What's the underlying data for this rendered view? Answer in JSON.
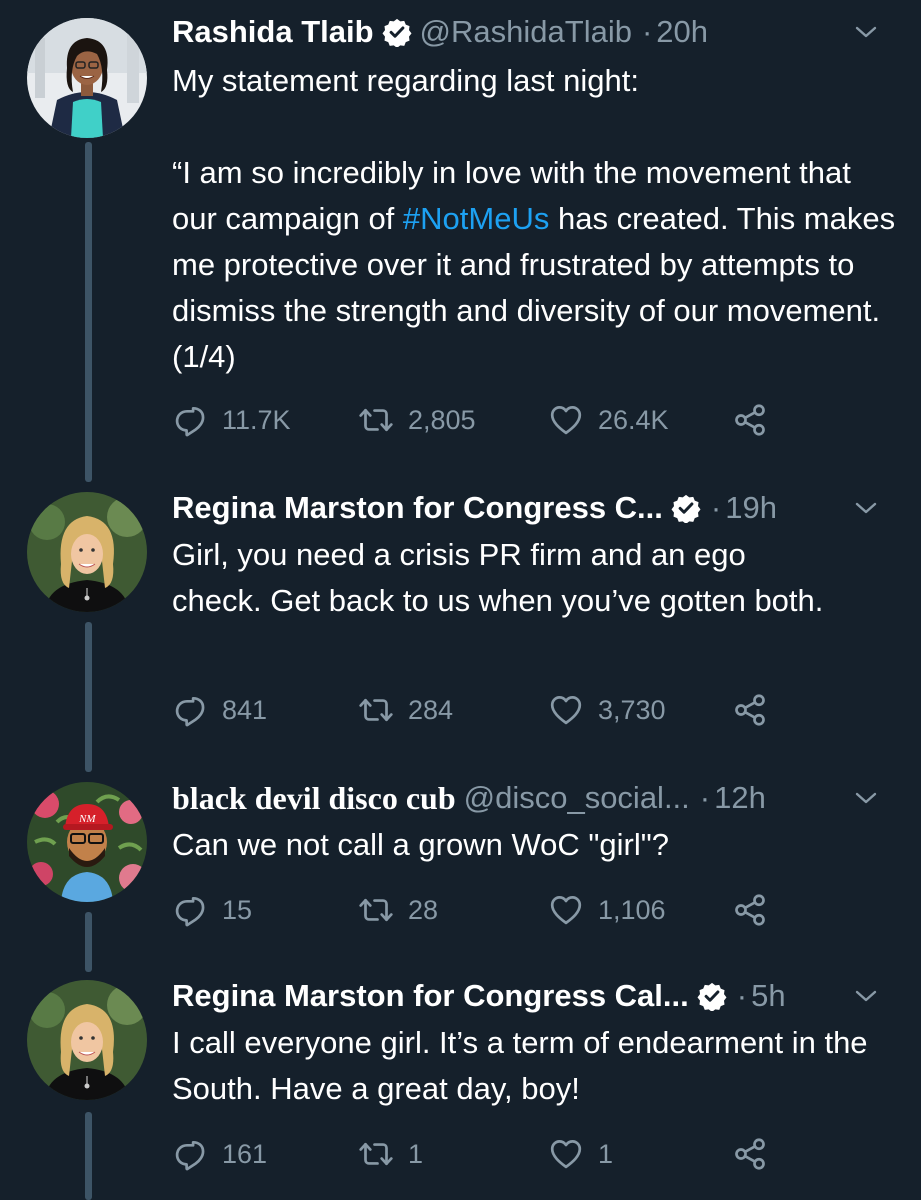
{
  "tweets": [
    {
      "name": "Rashida Tlaib",
      "handle": "@RashidaTlaib",
      "dot": "·",
      "time": "20h",
      "text_before": "My statement regarding last night:\n\n“I am so incredibly in love with the movement that our campaign of ",
      "hashtag": "#NotMeUs",
      "text_after": " has created. This makes me protective over it and frustrated by attempts to dismiss the strength and diversity of our movement. (1/4)",
      "replies": "11.7K",
      "retweets": "2,805",
      "likes": "26.4K"
    },
    {
      "name": "Regina Marston for Congress C...",
      "handle": "",
      "dot": "·",
      "time": "19h",
      "text": "Girl, you need a crisis PR firm and an ego check. Get back to us when you’ve gotten both.",
      "replies": "841",
      "retweets": "284",
      "likes": "3,730"
    },
    {
      "name": "black devil disco cub",
      "handle": "@disco_social...",
      "dot": "·",
      "time": "12h",
      "text": "Can we not call a grown WoC \"girl\"?",
      "replies": "15",
      "retweets": "28",
      "likes": "1,106"
    },
    {
      "name": "Regina Marston for Congress Cal...",
      "handle": "",
      "dot": "·",
      "time": "5h",
      "text": "I call everyone girl. It’s a term of endearment in the South. Have a great day, boy!",
      "replies": "161",
      "retweets": "1",
      "likes": "1"
    }
  ],
  "icons": {
    "verified": "verified-badge-icon",
    "caret": "chevron-down-icon",
    "reply": "reply-icon",
    "retweet": "retweet-icon",
    "like": "heart-icon",
    "share": "share-icon"
  },
  "colors": {
    "background": "#15202b",
    "text": "#ffffff",
    "secondary": "#8899a6",
    "link": "#1da1f2",
    "thread_line": "#3d5466"
  }
}
